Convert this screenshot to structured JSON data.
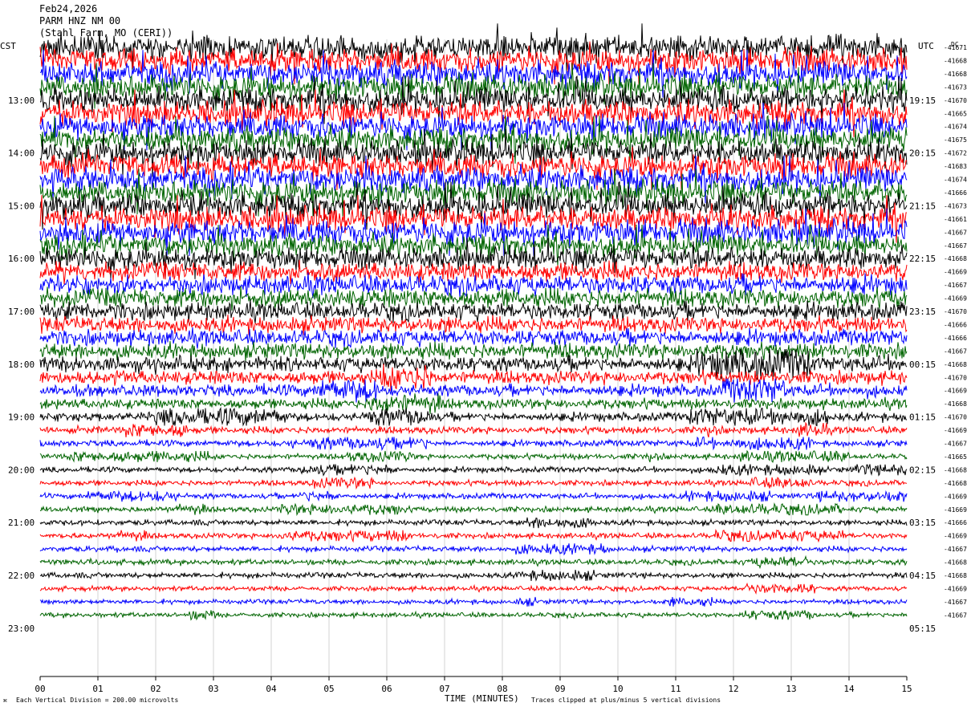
{
  "header": {
    "line1": "Feb24,2026",
    "line2": "PARM HNZ NM 00",
    "line3": "(Stahl Farm, MO (CERI))"
  },
  "axes": {
    "left_tz": "CST",
    "right_tz": "UTC",
    "dc_label": "DC",
    "xlabel": "TIME (MINUTES)"
  },
  "footer": {
    "scale_note": "Each Vertical Division =  200.00 microvolts",
    "clip_note": "Traces clipped at plus/minus 5 vertical divisions"
  },
  "colors": {
    "trace_cycle": [
      "#000000",
      "#ff0000",
      "#0000ff",
      "#006400"
    ],
    "background": "#ffffff",
    "gridline": "#000000"
  },
  "chart_data": {
    "type": "line",
    "chart_kind": "helicorder seismogram",
    "minutes_per_row": 15,
    "row_count": 44,
    "xlim": [
      0,
      15
    ],
    "x_ticks": [
      "00",
      "01",
      "02",
      "03",
      "04",
      "05",
      "06",
      "07",
      "08",
      "09",
      "10",
      "11",
      "12",
      "13",
      "14",
      "15"
    ],
    "left_hour_labels": [
      "13:00",
      "14:00",
      "15:00",
      "16:00",
      "17:00",
      "18:00",
      "19:00",
      "20:00",
      "21:00",
      "22:00",
      "23:00"
    ],
    "right_hour_labels": [
      "19:15",
      "20:15",
      "21:15",
      "22:15",
      "23:15",
      "00:15",
      "01:15",
      "02:15",
      "03:15",
      "04:15",
      "05:15"
    ],
    "first_hour_label_row": 4,
    "rows_per_hour": 4,
    "dc_offsets": [
      -41671,
      -41668,
      -41668,
      -41673,
      -41670,
      -41665,
      -41674,
      -41675,
      -41672,
      -41683,
      -41674,
      -41666,
      -41673,
      -41661,
      -41667,
      -41667,
      -41668,
      -41669,
      -41667,
      -41669,
      -41670,
      -41666,
      -41666,
      -41667,
      -41668,
      -41670,
      -41669,
      -41668,
      -41670,
      -41669,
      -41667,
      -41665,
      -41668,
      -41668,
      -41669,
      -41669,
      -41666,
      -41669,
      -41667,
      -41668,
      -41668,
      -41669,
      -41667,
      -41667
    ],
    "activity_level": [
      3,
      3,
      3,
      3,
      3,
      3,
      3,
      3,
      3,
      3,
      3,
      3,
      3,
      3,
      3,
      2.6,
      2.6,
      2.4,
      2.4,
      2.4,
      2.2,
      2,
      2,
      2,
      1.9,
      1.7,
      1.5,
      1.3,
      1.1,
      0.9,
      0.8,
      0.7,
      0.7,
      0.7,
      0.7,
      0.7,
      0.7,
      0.7,
      0.7,
      0.7,
      0.7,
      0.6,
      0.6,
      0.6
    ]
  }
}
